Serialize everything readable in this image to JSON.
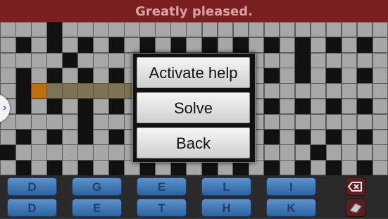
{
  "clue": "Greatly pleased.",
  "menu": {
    "items": [
      "Activate help",
      "Solve",
      "Back"
    ]
  },
  "side_tab": {
    "icon": "chevron-right-icon",
    "glyph": "›"
  },
  "keyboard": {
    "row1": [
      "D",
      "G",
      "E",
      "L",
      "I"
    ],
    "row2": [
      "D",
      "E",
      "T",
      "H",
      "K"
    ],
    "backspace_icon": "backspace-icon",
    "eraser_icon": "eraser-icon"
  },
  "grid": {
    "rows": 10,
    "cols": 25,
    "pattern": [
      "WWWBWWWWWWWWWWWWWWWWWWWWW",
      "WBWBWBWBWBWBWBWBWBWBWBWBW",
      "WWWWBWWWWWWWWWWWWWWBWWWWW",
      "WBWBWBWBWBWBWBWBWBWBWBWBW",
      "WBSHHHHHHBWWWWWWWWWWWWWWW",
      "WBWBWBWBWBWBWBWBWBWBWBWBW",
      "WWWWWBWWWWWWWWWBWWWWWWWWW",
      "WBWBWBWBWBWBWBWBWBWBWBWBW",
      "BWWWWWWWWBWWWWWWWWWWBWWWW",
      "WBWBWBWBWBWBWBWBWBWBWBWBW"
    ]
  },
  "colors": {
    "clue_bar": "#7a1f1f",
    "clue_text": "#d9a3a3",
    "cell_white": "#a7a7a7",
    "cell_black": "#111111",
    "selected_cell": "#c0700a",
    "highlighted_word": "#7f7355",
    "key_blue": "#4a7fbf"
  }
}
